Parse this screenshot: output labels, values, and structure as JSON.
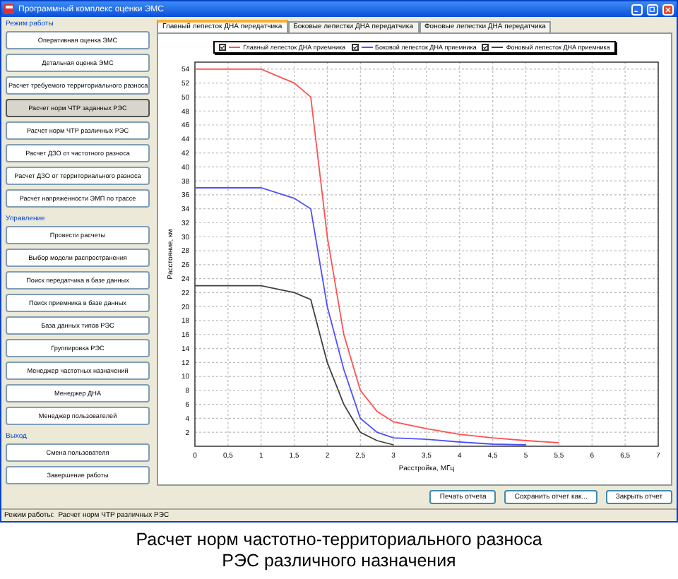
{
  "window": {
    "title": "Программный комплекс оценки ЭМС"
  },
  "sidebar": {
    "groups": [
      {
        "label": "Режим работы",
        "buttons": [
          {
            "label": "Оперативная оценка ЭМС",
            "selected": false
          },
          {
            "label": "Детальная оценка ЭМС",
            "selected": false
          },
          {
            "label": "Расчет требуемого территориального разноса",
            "selected": false
          },
          {
            "label": "Расчет норм ЧТР заданных РЭС",
            "selected": true
          },
          {
            "label": "Расчет норм ЧТР различных РЭС",
            "selected": false
          },
          {
            "label": "Расчет ДЗО от частотного разноса",
            "selected": false
          },
          {
            "label": "Расчет ДЗО от территориального разноса",
            "selected": false
          },
          {
            "label": "Расчет напряженности ЭМП по трассе",
            "selected": false
          }
        ]
      },
      {
        "label": "Управление",
        "buttons": [
          {
            "label": "Провести расчеты",
            "selected": false
          },
          {
            "label": "Выбор модели распространения",
            "selected": false
          },
          {
            "label": "Поиск передатчика в базе данных",
            "selected": false
          },
          {
            "label": "Поиск приемника в базе данных",
            "selected": false
          },
          {
            "label": "База данных типов РЭС",
            "selected": false
          },
          {
            "label": "Группировка РЭС",
            "selected": false
          },
          {
            "label": "Менеджер частотных назначений",
            "selected": false
          },
          {
            "label": "Менеджер ДНА",
            "selected": false
          },
          {
            "label": "Менеджер пользователей",
            "selected": false
          }
        ]
      },
      {
        "label": "Выход",
        "buttons": [
          {
            "label": "Смена пользователя",
            "selected": false
          },
          {
            "label": "Завершение работы",
            "selected": false
          }
        ]
      }
    ]
  },
  "tabs": [
    {
      "label": "Главный лепесток ДНА передатчика",
      "selected": true
    },
    {
      "label": "Боковые лепестки ДНА передатчика",
      "selected": false
    },
    {
      "label": "Фоновые лепестки ДНА передатчика",
      "selected": false
    }
  ],
  "tab_panel": {
    "legend_checkboxes": [
      {
        "checked": true
      },
      {
        "checked": true
      },
      {
        "checked": true
      }
    ],
    "chart_data": {
      "type": "line",
      "grid": true,
      "xlabel": "Расстройка, МГц",
      "ylabel": "Расстояние, км",
      "x": [
        0,
        0.5,
        1,
        1.5,
        1.75,
        2,
        2.25,
        2.5,
        2.75,
        3,
        3.5,
        4,
        4.5,
        5,
        5.5
      ],
      "series": [
        {
          "name": "Главный лепесток ДНА приемника",
          "color": "#ff5050",
          "values": [
            54,
            54,
            54,
            52,
            50,
            30,
            16,
            8,
            5,
            3.5,
            2.5,
            1.7,
            1.2,
            0.8,
            0.5
          ]
        },
        {
          "name": "Боковой лепесток ДНА приемника",
          "color": "#5050ff",
          "values": [
            37,
            37,
            37,
            35.5,
            34,
            20,
            11,
            4,
            2,
            1.2,
            1,
            0.6,
            0.3,
            0.2,
            null
          ]
        },
        {
          "name": "Фоновый лепесток ДНА приемника",
          "color": "#404040",
          "values": [
            23,
            23,
            23,
            22,
            21,
            12,
            6,
            2,
            0.8,
            0.2,
            null,
            null,
            null,
            null,
            null
          ]
        }
      ],
      "xlim": [
        0,
        7
      ],
      "ylim": [
        0,
        55
      ],
      "xticks": [
        0,
        {
          "value": 0.5,
          "label": "0,5"
        },
        1,
        {
          "value": 1.5,
          "label": "1,5"
        },
        2,
        {
          "value": 2.5,
          "label": "2,5"
        },
        3,
        {
          "value": 3.5,
          "label": "3,5"
        },
        4,
        {
          "value": 4.5,
          "label": "4,5"
        },
        5,
        {
          "value": 5.5,
          "label": "5,5"
        },
        6,
        {
          "value": 6.5,
          "label": "6,5"
        },
        7
      ],
      "yticks": [
        2,
        4,
        6,
        8,
        10,
        12,
        14,
        16,
        18,
        20,
        22,
        24,
        26,
        28,
        30,
        32,
        34,
        36,
        38,
        40,
        42,
        44,
        46,
        48,
        50,
        52,
        54
      ]
    }
  },
  "report_buttons": [
    "Печать отчета",
    "Сохранить отчет как...",
    "Закрыть отчет"
  ],
  "status_bar": {
    "label": "Режим работы:",
    "value": "Расчет норм ЧТР различных РЭС"
  },
  "caption": [
    "Расчет норм частотно-территориального разноса",
    "РЭС различного назначения"
  ]
}
